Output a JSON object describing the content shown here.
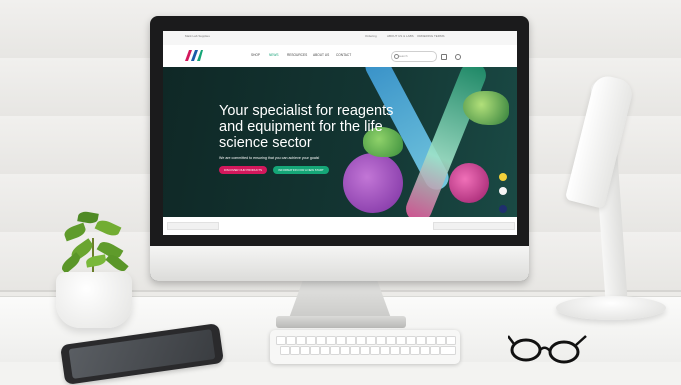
{
  "scene": {
    "description_colors": {
      "wall": "#ecebe8",
      "desk": "#f3f3f1",
      "monitor_bezel": "#1b1b1c",
      "hero_bg": "#133532",
      "primary_button": "#d3185c",
      "secondary_button": "#15a677",
      "nav_active": "#1aa37a"
    }
  },
  "website": {
    "topbar": {
      "left_text": "Mark Lab Supplies",
      "links": [
        "Ordering",
        "ABOUT US & LABS",
        "ORDERING TERMS"
      ]
    },
    "nav": {
      "logo_icon": "brand-logo-icon",
      "items": [
        "SHOP",
        "NEWS",
        "RESOURCES",
        "ABOUT US",
        "CONTACT"
      ],
      "active_index": 1,
      "search_placeholder": "Search",
      "icons": [
        "cart-icon",
        "user-icon"
      ]
    },
    "hero": {
      "title": "Your specialist for reagents and equipment for the life science sector",
      "subtitle": "We are committed to ensuring that you can achieve your goals!",
      "primary_button": "DISCOVER OUR PRODUCTS",
      "secondary_button": "INFORMATION FOR A NEW START"
    }
  }
}
